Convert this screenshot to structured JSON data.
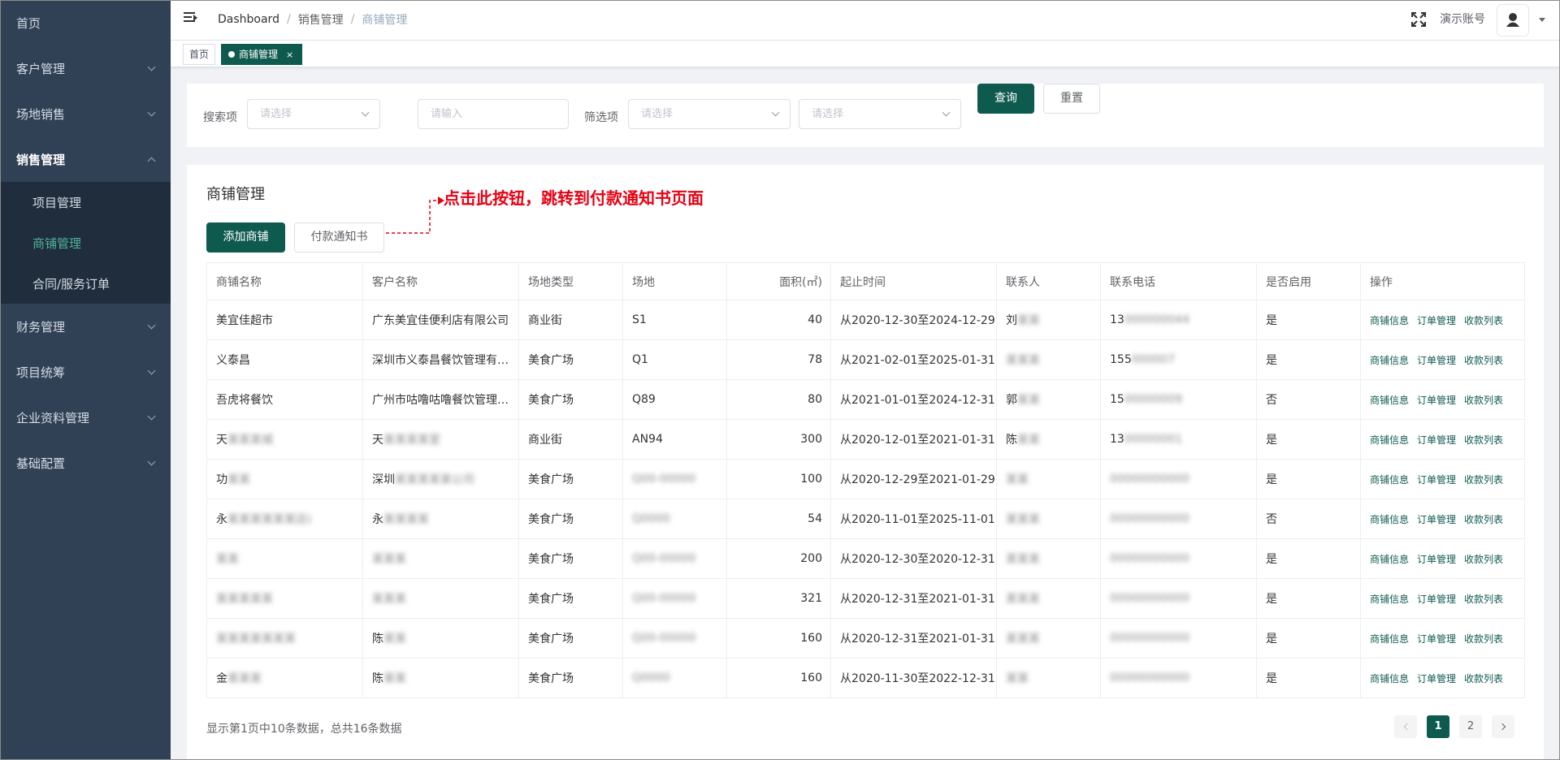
{
  "sidebar": {
    "items": [
      {
        "label": "首页"
      },
      {
        "label": "客户管理"
      },
      {
        "label": "场地销售"
      },
      {
        "label": "销售管理"
      },
      {
        "label": "财务管理"
      },
      {
        "label": "项目统筹"
      },
      {
        "label": "企业资料管理"
      },
      {
        "label": "基础配置"
      }
    ],
    "sub_items": [
      {
        "label": "项目管理"
      },
      {
        "label": "商铺管理"
      },
      {
        "label": "合同/服务订单"
      }
    ]
  },
  "header": {
    "breadcrumb": [
      "Dashboard",
      "销售管理",
      "商铺管理"
    ],
    "account_name": "演示账号"
  },
  "tags": {
    "home": "首页",
    "current": "商铺管理",
    "close": "×"
  },
  "search": {
    "search_label": "搜索项",
    "select_placeholder": "请选择",
    "input_placeholder": "请输入",
    "filter_label": "筛选项",
    "filter1_placeholder": "请选择",
    "filter2_placeholder": "请选择",
    "query_button": "查询",
    "reset_button": "重置"
  },
  "main": {
    "title": "商铺管理",
    "add_button": "添加商铺",
    "notice_button": "付款通知书",
    "annotation": "点击此按钮，跳转到付款通知书页面"
  },
  "table": {
    "columns": [
      "商铺名称",
      "客户名称",
      "场地类型",
      "场地",
      "面积(㎡)",
      "起止时间",
      "联系人",
      "联系电话",
      "是否启用",
      "操作"
    ],
    "actions": [
      "商铺信息",
      "订单管理",
      "收款列表"
    ],
    "rows": [
      [
        "美宜佳超市",
        "广东美宜佳便利店有限公司",
        "商业街",
        "S1",
        "40",
        "从2020-12-30至2024-12-29",
        "刘",
        "13",
        "是"
      ],
      [
        "义泰昌",
        "深圳市义泰昌餐饮管理有限公司",
        "美食广场",
        "Q1",
        "78",
        "从2021-02-01至2025-01-31",
        "",
        "155",
        "是"
      ],
      [
        "吾虎将餐饮",
        "广州市咕噜咕噜餐饮管理有限公司",
        "美食广场",
        "Q89",
        "80",
        "从2021-01-01至2024-12-31",
        "郭",
        "15",
        "否"
      ],
      [
        "天",
        "天",
        "商业街",
        "AN94",
        "300",
        "从2020-12-01至2021-01-31",
        "陈",
        "13",
        "是"
      ],
      [
        "功",
        "深圳",
        "美食广场",
        "",
        "100",
        "从2020-12-29至2021-01-29",
        "",
        "",
        "是"
      ],
      [
        "永",
        "永",
        "美食广场",
        "",
        "54",
        "从2020-11-01至2025-11-01",
        "",
        "",
        "否"
      ],
      [
        "",
        "",
        "美食广场",
        "",
        "200",
        "从2020-12-30至2020-12-31",
        "",
        "",
        "是"
      ],
      [
        "",
        "",
        "美食广场",
        "",
        "321",
        "从2020-12-31至2021-01-31",
        "",
        "",
        "是"
      ],
      [
        "",
        "陈",
        "美食广场",
        "",
        "160",
        "从2020-12-31至2021-01-31",
        "",
        "",
        "是"
      ],
      [
        "金",
        "陈",
        "美食广场",
        "",
        "160",
        "从2020-11-30至2022-12-31",
        "",
        "",
        "是"
      ]
    ]
  },
  "footer": {
    "info": "显示第1页中10条数据，总共16条数据",
    "pages": [
      "1",
      "2"
    ],
    "current_page": "1"
  },
  "colors": {
    "primary": "#0f5a4f",
    "sidebar_bg": "#304156",
    "annotation": "#e60012"
  },
  "icons": {
    "hamburger": "hamburger-icon",
    "fullscreen": "fullscreen-icon",
    "avatar": "user-icon",
    "chevron": "chevron-down-icon"
  }
}
